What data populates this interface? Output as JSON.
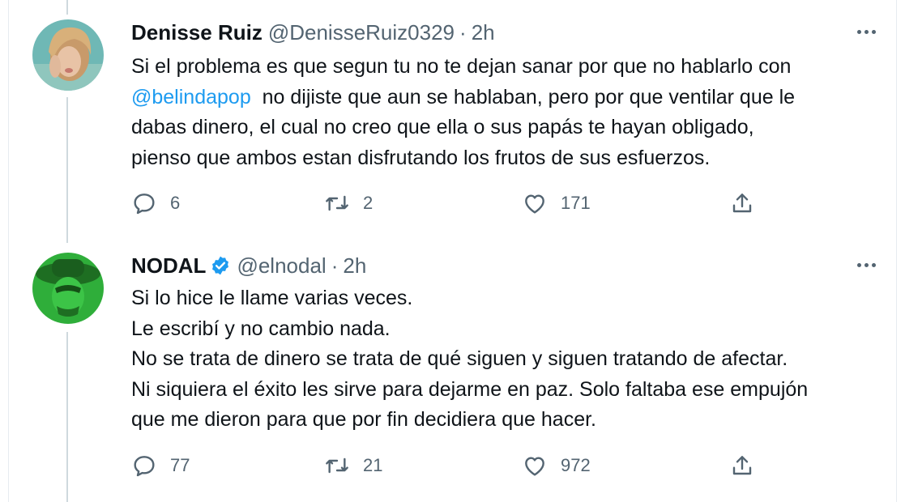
{
  "colors": {
    "text": "#0f1419",
    "secondary": "#536471",
    "accent": "#1d9bf0",
    "divider": "#cfd9de"
  },
  "tweets": [
    {
      "name": "Denisse Ruiz",
      "handle": "@DenisseRuiz0329",
      "sep": "·",
      "time": "2h",
      "verified": false,
      "lines": [
        {
          "pre": "Si el problema es que segun tu no te dejan sanar por que no hablarlo con"
        },
        {
          "mention": "@belindapop",
          "post": "  no dijiste que aun se hablaban, pero por que ventilar que le"
        },
        {
          "pre": "dabas dinero, el cual no creo que ella o sus papás te hayan obligado,"
        },
        {
          "pre": "pienso que ambos estan disfrutando los frutos de sus esfuerzos."
        }
      ],
      "replies": "6",
      "retweets": "2",
      "likes": "171",
      "reply_icon": "reply-icon",
      "retweet_icon": "retweet-icon",
      "like_icon": "heart-icon",
      "share_icon": "share-icon"
    },
    {
      "name": "NODAL",
      "handle": "@elnodal",
      "sep": "·",
      "time": "2h",
      "verified": true,
      "lines": [
        {
          "pre": "Si lo hice le llame varias veces."
        },
        {
          "pre": "Le escribí y no cambio nada."
        },
        {
          "pre": "No se trata de dinero se trata de qué siguen y siguen tratando de afectar."
        },
        {
          "pre": "Ni siquiera el éxito les sirve para dejarme en paz. Solo faltaba ese empujón"
        },
        {
          "pre": "que me dieron para que por fin decidiera que hacer."
        }
      ],
      "replies": "77",
      "retweets": "21",
      "likes": "972",
      "reply_icon": "reply-icon",
      "retweet_icon": "retweet-icon",
      "like_icon": "heart-icon",
      "share_icon": "share-icon"
    }
  ]
}
